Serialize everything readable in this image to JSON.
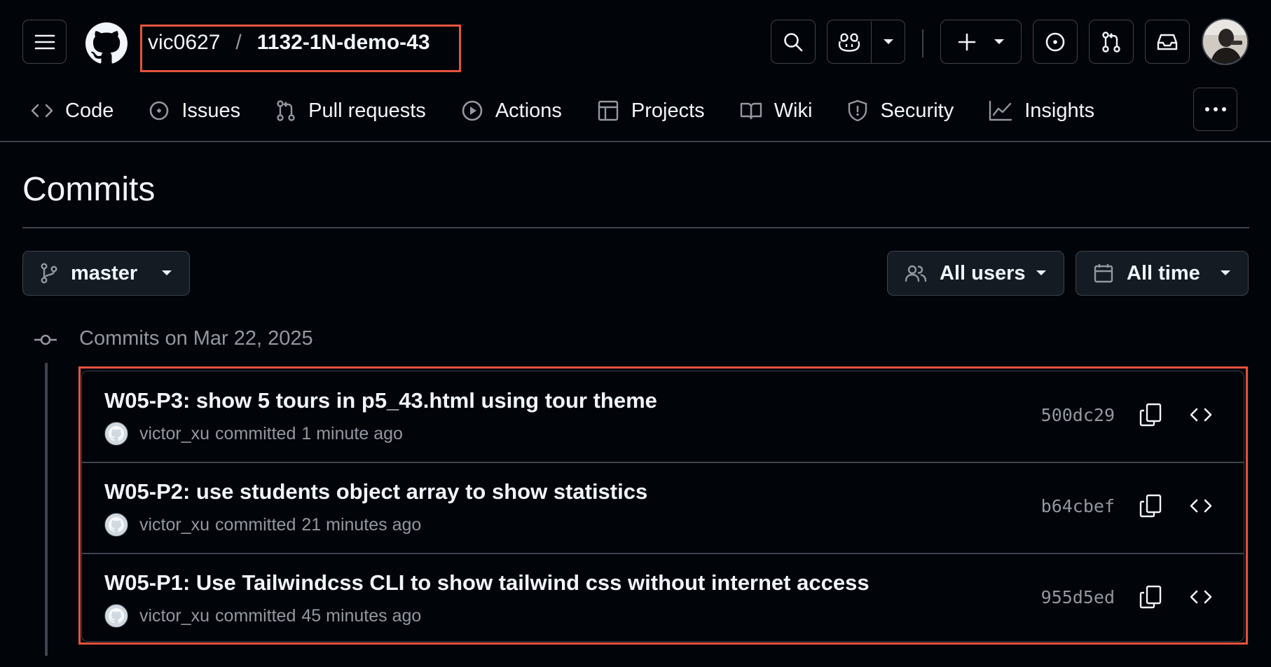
{
  "header": {
    "repo_owner": "vic0627",
    "repo_separator": "/",
    "repo_name": "1132-1N-demo-43"
  },
  "tabs": [
    {
      "label": "Code",
      "icon": "code-icon"
    },
    {
      "label": "Issues",
      "icon": "issue-opened-icon"
    },
    {
      "label": "Pull requests",
      "icon": "git-pull-request-icon"
    },
    {
      "label": "Actions",
      "icon": "play-icon"
    },
    {
      "label": "Projects",
      "icon": "table-icon"
    },
    {
      "label": "Wiki",
      "icon": "book-icon"
    },
    {
      "label": "Security",
      "icon": "shield-icon"
    },
    {
      "label": "Insights",
      "icon": "graph-icon"
    }
  ],
  "page": {
    "title": "Commits"
  },
  "filters": {
    "branch": "master",
    "users": "All users",
    "time": "All time"
  },
  "group": {
    "label": "Commits on Mar 22, 2025"
  },
  "commits": [
    {
      "message": "W05-P3: show 5 tours in p5_43.html using tour theme",
      "author": "victor_xu",
      "verb": "committed",
      "time": "1 minute ago",
      "sha": "500dc29"
    },
    {
      "message": "W05-P2: use students object array to show statistics",
      "author": "victor_xu",
      "verb": "committed",
      "time": "21 minutes ago",
      "sha": "b64cbef"
    },
    {
      "message": "W05-P1: Use Tailwindcss CLI to show tailwind css without internet access",
      "author": "victor_xu",
      "verb": "committed",
      "time": "45 minutes ago",
      "sha": "955d5ed"
    }
  ],
  "colors": {
    "background": "#010409",
    "border": "#3d444d",
    "text": "#f0f6fc",
    "muted": "#9198a1",
    "highlight": "#e5533d"
  }
}
